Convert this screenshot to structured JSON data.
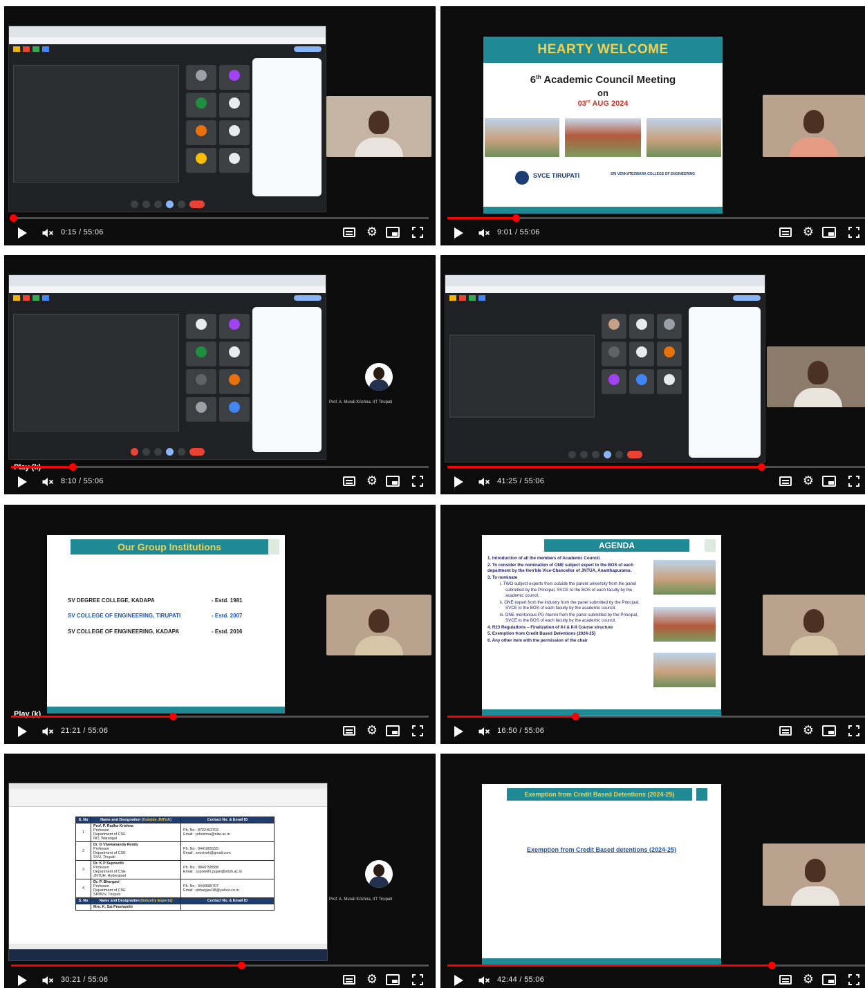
{
  "player": {
    "play_tooltip": "Play (k)",
    "tiles": [
      {
        "time": "0:15 / 55:06",
        "progress": 0.0045
      },
      {
        "time": "9:01 / 55:06",
        "progress": 0.164
      },
      {
        "time": "8:10 / 55:06",
        "progress": 0.148
      },
      {
        "time": "41:25 / 55:06",
        "progress": 0.752
      },
      {
        "time": "21:21 / 55:06",
        "progress": 0.388
      },
      {
        "time": "16:50 / 55:06",
        "progress": 0.306
      },
      {
        "time": "30:21 / 55:06",
        "progress": 0.551
      },
      {
        "time": "42:44 / 55:06",
        "progress": 0.776
      }
    ]
  },
  "participants": {
    "murali": "Prof. A. Murali Krishna, IIT Tirupati"
  },
  "welcome_slide": {
    "heading": "HEARTY WELCOME",
    "meeting_prefix": "6",
    "meeting_sup": "th",
    "meeting_title": " Academic Council Meeting",
    "on": "on",
    "date_prefix": "03",
    "date_sup": "rd",
    "date_rest": " AUG 2024",
    "logo_text": "SVCE TIRUPATI",
    "college": "SRI VENKATESWARA COLLEGE OF ENGINEERING"
  },
  "group_slide": {
    "title": "Our Group Institutions",
    "institutions": [
      {
        "name": "SV DEGREE COLLEGE, KADAPA",
        "estd": "- Estd. 1981"
      },
      {
        "name": "SV COLLEGE OF ENGINEERING, TIRUPATI",
        "estd": "- Estd. 2007"
      },
      {
        "name": "SV COLLEGE OF ENGINEERING, KADAPA",
        "estd": "- Estd. 2016"
      }
    ]
  },
  "agenda_slide": {
    "title": "AGENDA",
    "items": [
      "1.  Introduction of all the members of Academic Council.",
      "2.  To consider the nomination of ONE subject expert to the BOS of each department by the Hon'ble Vice-Chancellor of JNTUA, Ananthapuramu.",
      "3.  To nominate"
    ],
    "subitems": [
      "i.  TWO subject experts from outside the parent university from the panel submitted by the Principal, SVCE to the BOS of each faculty by the academic council.",
      "ii.  ONE expert from the industry from the panel submitted by the Principal, SVCE to the BOS of each faculty by the academic council.",
      "iii.  ONE meritorious PG Alumni from the panel submitted by the Principal, SVCE to the BOS of each faculty by the academic council."
    ],
    "items_after": [
      "4.  R23 Regulations – Finalization of II-I & II-II Course structure",
      "5.  Exemption from Credit Based Detentions (2024-25)",
      "6.  Any other item with the permission of the chair"
    ]
  },
  "exemption_slide": {
    "title": "Exemption from Credit Based Detentions (2024-25)",
    "link": "Exemption from Credit Based detentions (2024-25)"
  },
  "doc_table": {
    "header_sno": "S. No",
    "header_name": "Name and Designation ",
    "header_name_tag": "[Outside JNTUA]",
    "header_contact": "Contact No. & Email ID",
    "rows": [
      {
        "sn": "1",
        "name": "Prof. P. Radha Krishna",
        "lines": [
          "Professor",
          "Department of CSE",
          "NIT, Warangal"
        ],
        "phone": "Ph. No : 8702462703",
        "email": "Email : prkrishna@nitw.ac.in"
      },
      {
        "sn": "2",
        "name": "Dr. D Vivekananda Reddy",
        "lines": [
          "Professor",
          "Department of CSE",
          "SVU, Tirupati"
        ],
        "phone": "Ph. No : 9441005225",
        "email": "Email : svuvivek@gmail.com"
      },
      {
        "sn": "3",
        "name": "Dr. K P Supreethi",
        "lines": [
          "Professor",
          "Department of CSE",
          "JNTUH, Hyderabad"
        ],
        "phone": "Ph. No : 9849758588",
        "email": "Email : supreethi.pujari@jntuh.ac.in"
      },
      {
        "sn": "4",
        "name": "Dr. P. Bhargavi",
        "lines": [
          "Professor",
          "Department of CSE",
          "SPMVV, Tirupati"
        ],
        "phone": "Ph. No : 9440685707",
        "email": "Email : pbhargavi18@yahoo.co.in"
      }
    ],
    "header2_sno": "S. No",
    "header2_name": "Name and Designation ",
    "header2_name_tag": "[Industry Experts]",
    "header2_contact": "Contact No. & Email ID",
    "row5_name": "Mrs. K. Sai Prashanthi"
  },
  "colors": {
    "accent": "#ff0000",
    "teal": "#1f8a96",
    "banner_text": "#f6d24a",
    "navy": "#1f3d6e"
  }
}
